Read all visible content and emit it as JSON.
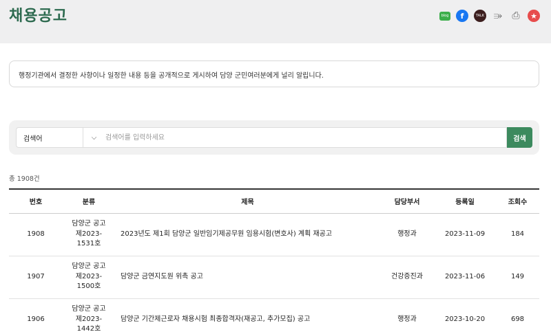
{
  "header": {
    "title": "채용공고"
  },
  "share": {
    "blog_label": "blog",
    "facebook_label": "f",
    "talk_label": "TALK",
    "icons": [
      "naver-blog-icon",
      "facebook-icon",
      "kakaotalk-icon",
      "share-icon",
      "print-icon",
      "favorite-icon"
    ]
  },
  "intro": {
    "text": "행정기관에서 결정한 사항이나 일정한 내용 등을 공개적으로 게시하여 담양 군민여러분에게 널리 알립니다."
  },
  "search": {
    "select_value": "검색어",
    "placeholder": "검색어를 입력하세요",
    "button_label": "검색"
  },
  "total": {
    "label": "총 1908건"
  },
  "table": {
    "headers": {
      "no": "번호",
      "category": "분류",
      "title": "제목",
      "dept": "담당부서",
      "date": "등록일",
      "views": "조회수"
    },
    "rows": [
      {
        "no": "1908",
        "category": [
          "담양군 공고",
          "제2023-",
          "1531호"
        ],
        "title": "2023년도 제1회 담양군 일반임기제공무원 임용시험(변호사) 계획 재공고",
        "dept": "행정과",
        "date": "2023-11-09",
        "views": "184"
      },
      {
        "no": "1907",
        "category": [
          "담양군 공고",
          "제2023-",
          "1500호"
        ],
        "title": "담양군 금연지도원 위촉 공고",
        "dept": "건강증진과",
        "date": "2023-11-06",
        "views": "149"
      },
      {
        "no": "1906",
        "category": [
          "담양군 공고",
          "제2023-",
          "1442호"
        ],
        "title": "담양군 기간제근로자 채용시험 최종합격자(재공고, 추가모집) 공고",
        "dept": "행정과",
        "date": "2023-10-20",
        "views": "698"
      }
    ]
  },
  "colors": {
    "accent": "#3c8a5e",
    "title": "#2d6a4f",
    "header_bg": "#efeff0"
  }
}
